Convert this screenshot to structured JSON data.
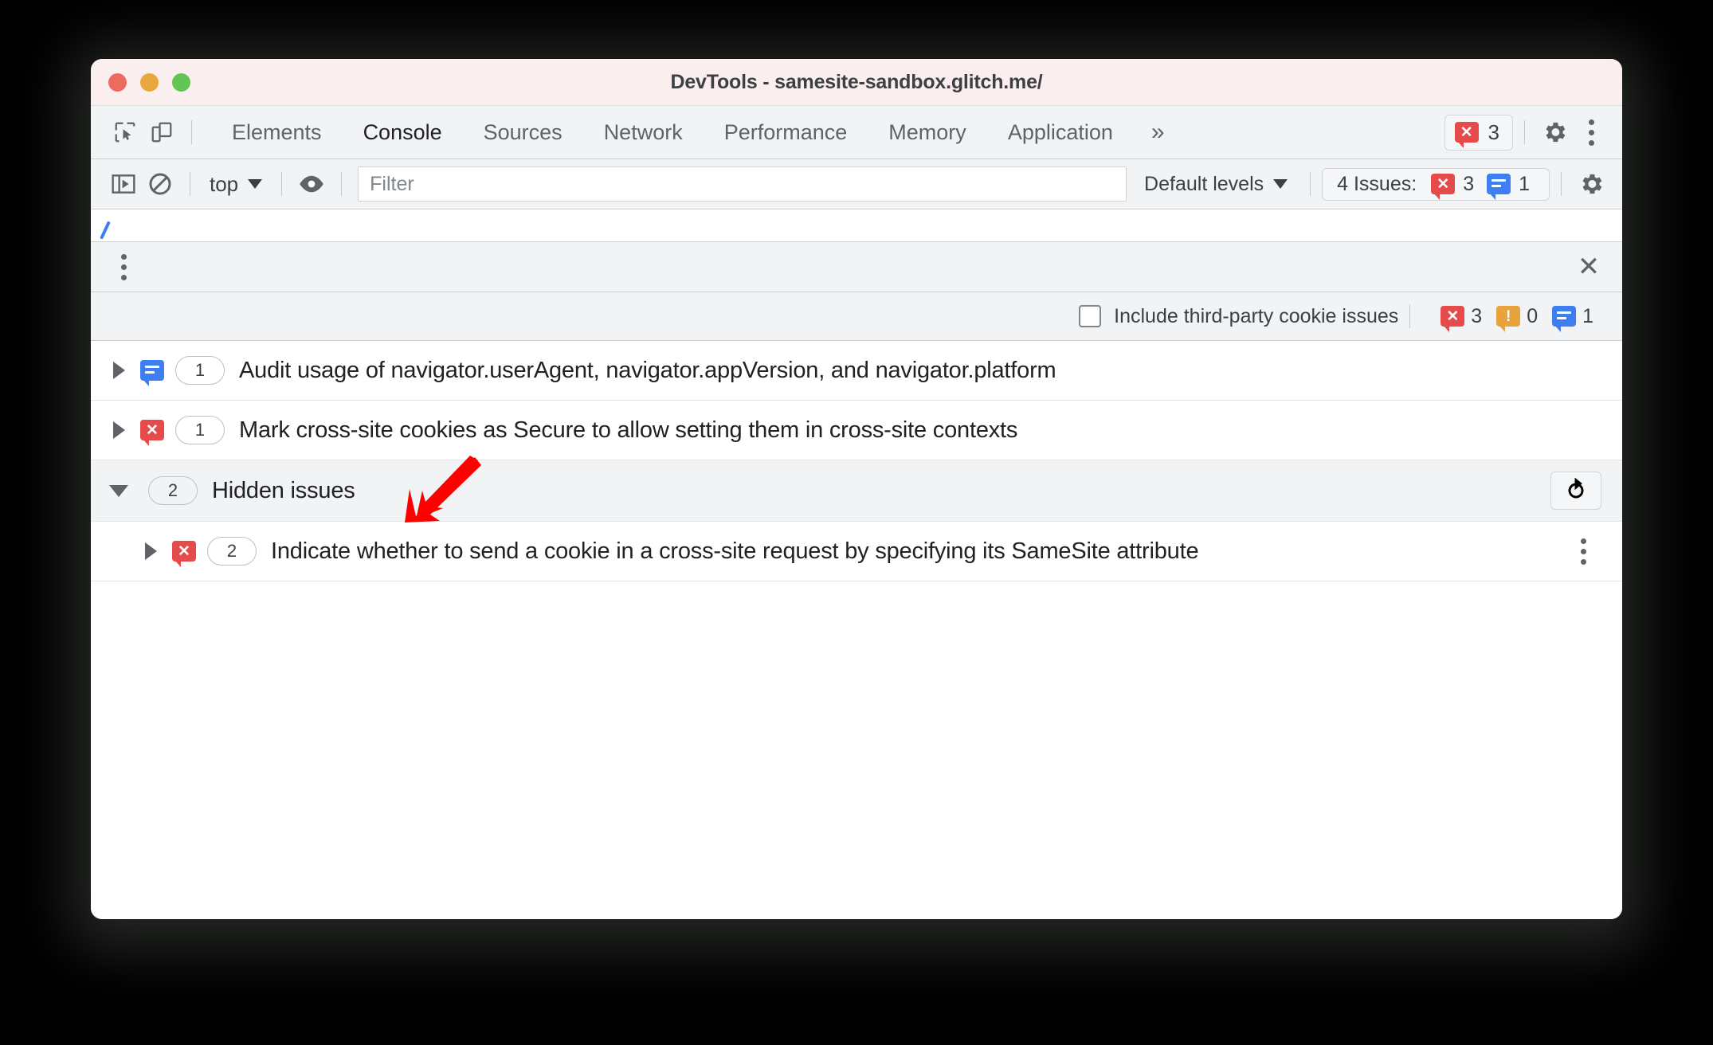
{
  "window": {
    "title": "DevTools - samesite-sandbox.glitch.me/",
    "traffic_lights": [
      "close",
      "minimize",
      "zoom"
    ],
    "colors": {
      "titlebar_bg": "#fbeeee",
      "toolbar_bg": "#f1f3f4",
      "error_red": "#e54b4b",
      "info_blue": "#3d7ef0",
      "warning_orange": "#e8a33d",
      "annotation_red": "#ff0000"
    }
  },
  "tabbar": {
    "inspect_icon": "inspect-element-icon",
    "device_icon": "device-toolbar-icon",
    "tabs": [
      {
        "label": "Elements",
        "active": false
      },
      {
        "label": "Console",
        "active": true
      },
      {
        "label": "Sources",
        "active": false
      },
      {
        "label": "Network",
        "active": false
      },
      {
        "label": "Performance",
        "active": false
      },
      {
        "label": "Memory",
        "active": false
      },
      {
        "label": "Application",
        "active": false
      }
    ],
    "more_tabs": "»",
    "error_badge": {
      "icon": "error-bubble-icon",
      "count": "3"
    },
    "settings_icon": "gear-icon",
    "menu_icon": "kebab-menu-icon"
  },
  "console_toolbar": {
    "sidebar_toggle_icon": "console-sidebar-icon",
    "clear_icon": "clear-console-icon",
    "context": "top",
    "eye_icon": "live-expression-eye-icon",
    "filter": {
      "value": "",
      "placeholder": "Filter"
    },
    "levels": "Default levels",
    "issues_pill": {
      "label": "4 Issues:",
      "error_count": "3",
      "info_count": "1"
    },
    "settings_icon": "gear-icon"
  },
  "drawer": {
    "menu_icon": "kebab-menu-icon",
    "close_icon": "close-icon"
  },
  "issues_panel": {
    "third_party_checkbox": {
      "label": "Include third-party cookie issues",
      "checked": false
    },
    "counts": {
      "errors": "3",
      "warnings": "0",
      "info": "1"
    },
    "rows": [
      {
        "kind": "issue",
        "severity": "info",
        "count": "1",
        "expanded": false,
        "title": "Audit usage of navigator.userAgent, navigator.appVersion, and navigator.platform"
      },
      {
        "kind": "issue",
        "severity": "error",
        "count": "1",
        "expanded": false,
        "title": "Mark cross-site cookies as Secure to allow setting them in cross-site contexts"
      },
      {
        "kind": "group",
        "count": "2",
        "expanded": true,
        "title": "Hidden issues",
        "action_icon": "refresh-icon"
      },
      {
        "kind": "issue",
        "severity": "error",
        "count": "2",
        "expanded": false,
        "nested": true,
        "title": "Indicate whether to send a cookie in a cross-site request by specifying its SameSite attribute",
        "menu_icon": "kebab-menu-icon"
      }
    ]
  },
  "annotation": {
    "type": "arrow",
    "direction": "down-left",
    "color": "#ff0000"
  }
}
